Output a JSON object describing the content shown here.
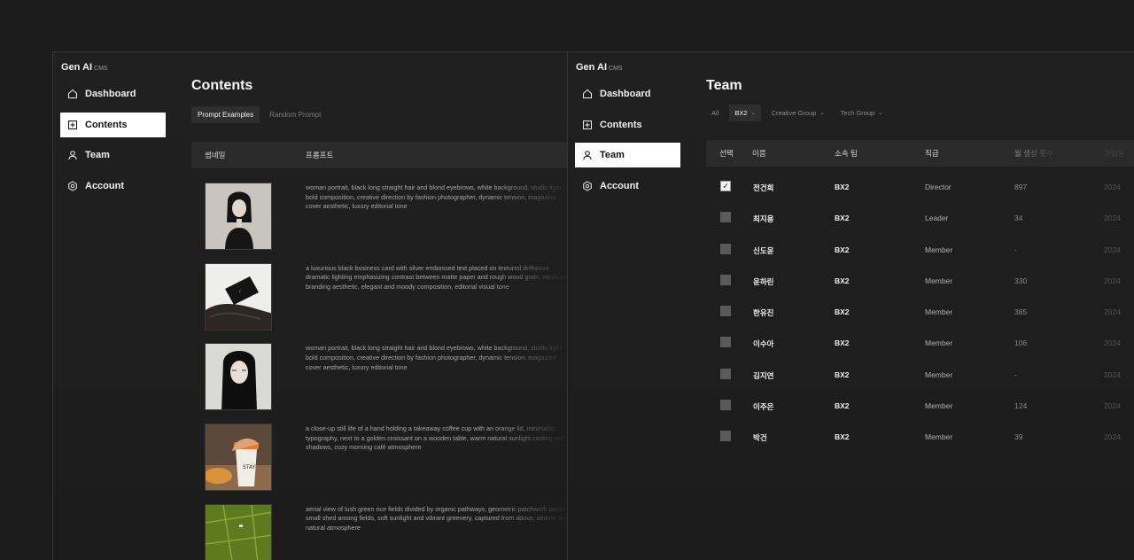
{
  "brand": {
    "name": "Gen AI",
    "sub": "CMS"
  },
  "nav": [
    {
      "label": "Dashboard",
      "icon": "home-icon"
    },
    {
      "label": "Contents",
      "icon": "plus-square-icon"
    },
    {
      "label": "Team",
      "icon": "user-icon"
    },
    {
      "label": "Account",
      "icon": "gear-icon"
    }
  ],
  "contents": {
    "title": "Contents",
    "tabs": [
      "Prompt Examples",
      "Random Prompt"
    ],
    "columns": {
      "thumbnail": "썸네일",
      "prompt": "프롬프트"
    },
    "rows": [
      {
        "prompt": "woman portrait, black long straight hair and blond eyebrows, white background, studio light - bold composition, creative direction by fashion photographer, dynamic tension, magazine cover aesthetic, luxury editorial tone"
      },
      {
        "prompt": "a luxurious black business card with silver embossed text placed on textured driftwood, dramatic lighting emphasizing contrast between matte paper and rough wood grain, minimalist branding aesthetic, elegant and moody composition, editorial visual tone"
      },
      {
        "prompt": "woman portrait, black long straight hair and blond eyebrows, white background, studio light - bold composition, creative direction by fashion photographer, dynamic tension, magazine cover aesthetic, luxury editorial tone"
      },
      {
        "prompt": "a close-up still life of a hand holding a takeaway coffee cup with an orange lid, minimalist typography, next to a golden croissant on a wooden table, warm natural sunlight casting soft shadows, cozy morning café atmosphere"
      },
      {
        "prompt": "aerial view of lush green rice fields divided by organic pathways, geometric patchwork pattern, small shed among fields, soft sunlight and vibrant greenery, captured from above, serene and natural atmosphere"
      }
    ]
  },
  "team": {
    "title": "Team",
    "filters": [
      {
        "label": "All",
        "dropdown": false
      },
      {
        "label": "BX2",
        "dropdown": true
      },
      {
        "label": "Creative Group",
        "dropdown": true
      },
      {
        "label": "Tech Group",
        "dropdown": true
      }
    ],
    "columns": {
      "select": "선택",
      "name": "이름",
      "team": "소속 팀",
      "rank": "직급",
      "count": "월 생성 횟수",
      "date": "가입일"
    },
    "members": [
      {
        "name": "전건희",
        "team": "BX2",
        "rank": "Director",
        "count": "897",
        "date": "2024",
        "checked": true
      },
      {
        "name": "최지용",
        "team": "BX2",
        "rank": "Leader",
        "count": "34",
        "date": "2024",
        "checked": false
      },
      {
        "name": "신도윤",
        "team": "BX2",
        "rank": "Member",
        "count": "-",
        "date": "2024",
        "checked": false
      },
      {
        "name": "윤하린",
        "team": "BX2",
        "rank": "Member",
        "count": "330",
        "date": "2024",
        "checked": false
      },
      {
        "name": "한유진",
        "team": "BX2",
        "rank": "Member",
        "count": "385",
        "date": "2024",
        "checked": false
      },
      {
        "name": "이수아",
        "team": "BX2",
        "rank": "Member",
        "count": "106",
        "date": "2024",
        "checked": false
      },
      {
        "name": "김지연",
        "team": "BX2",
        "rank": "Member",
        "count": "-",
        "date": "2024",
        "checked": false
      },
      {
        "name": "이주은",
        "team": "BX2",
        "rank": "Member",
        "count": "124",
        "date": "2024",
        "checked": false
      },
      {
        "name": "박건",
        "team": "BX2",
        "rank": "Member",
        "count": "39",
        "date": "2024",
        "checked": false
      }
    ]
  }
}
